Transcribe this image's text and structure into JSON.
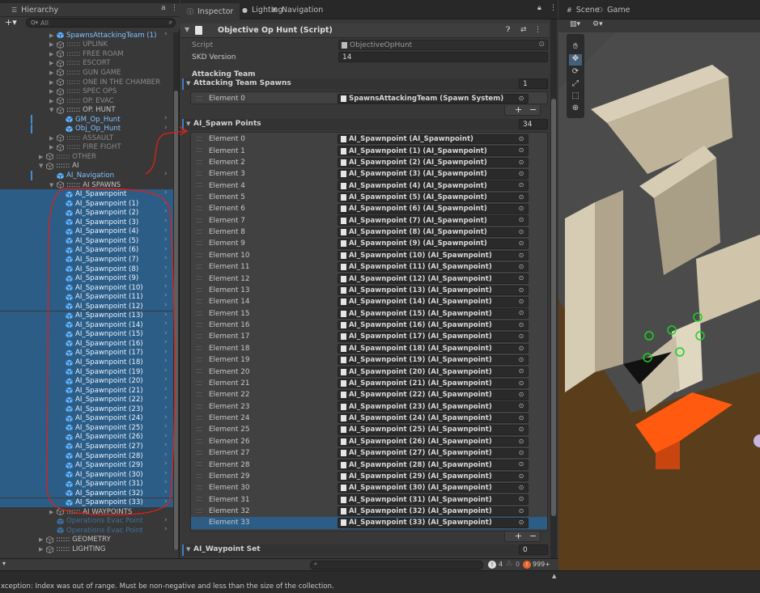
{
  "hierarchy": {
    "tab_label": "Hierarchy",
    "search_placeholder": "All",
    "items": [
      {
        "label": "SpawnsAttackingTeam (1)",
        "kind": "prefab",
        "indent": 1,
        "chev": true,
        "arrow": "▶",
        "blue": true
      },
      {
        "label": ":::::: UPLINK",
        "kind": "group",
        "indent": 1,
        "arrow": "▶",
        "dim": true
      },
      {
        "label": ":::::: FREE ROAM",
        "kind": "group",
        "indent": 1,
        "arrow": "▶",
        "dim": true
      },
      {
        "label": ":::::: ESCORT",
        "kind": "group",
        "indent": 1,
        "arrow": "▶",
        "dim": true
      },
      {
        "label": ":::::: GUN GAME",
        "kind": "group",
        "indent": 1,
        "arrow": "▶",
        "dim": true
      },
      {
        "label": ":::::: ONE IN THE CHAMBER",
        "kind": "group",
        "indent": 1,
        "arrow": "▶",
        "dim": true
      },
      {
        "label": ":::::: SPEC OPS",
        "kind": "group",
        "indent": 1,
        "arrow": "▶",
        "dim": true
      },
      {
        "label": ":::::: OP. EVAC",
        "kind": "group",
        "indent": 1,
        "arrow": "▶",
        "dim": true
      },
      {
        "label": ":::::: OP. HUNT",
        "kind": "group",
        "indent": 1,
        "arrow": "▼"
      },
      {
        "label": "GM_Op_Hunt",
        "kind": "prefab",
        "indent": 2,
        "chev": true,
        "blue": true,
        "mark": true
      },
      {
        "label": "Obj_Op_Hunt",
        "kind": "prefab",
        "indent": 2,
        "chev": true,
        "blue": true,
        "mark": true
      },
      {
        "label": ":::::: ASSAULT",
        "kind": "group",
        "indent": 1,
        "arrow": "▶",
        "dim": true
      },
      {
        "label": ":::::: FIRE FIGHT",
        "kind": "group",
        "indent": 1,
        "arrow": "▶",
        "dim": true
      },
      {
        "label": ":::::: OTHER",
        "kind": "group",
        "indent": 0,
        "arrow": "▶",
        "dim": true
      },
      {
        "label": ":::::: AI",
        "kind": "group",
        "indent": 0,
        "arrow": "▼"
      },
      {
        "label": "AI_Navigation",
        "kind": "prefab",
        "indent": 1,
        "chev": true,
        "blue": true,
        "mark": true
      },
      {
        "label": ":::::: AI SPAWNS",
        "kind": "group",
        "indent": 1,
        "arrow": "▼"
      },
      {
        "label": "AI_Spawnpoint",
        "kind": "prefab",
        "indent": 2,
        "chev": true
      },
      {
        "label": "AI_Spawnpoint (1)",
        "kind": "prefab",
        "indent": 2,
        "chev": true
      },
      {
        "label": "AI_Spawnpoint (2)",
        "kind": "prefab",
        "indent": 2,
        "chev": true
      },
      {
        "label": "AI_Spawnpoint (3)",
        "kind": "prefab",
        "indent": 2,
        "chev": true
      },
      {
        "label": "AI_Spawnpoint (4)",
        "kind": "prefab",
        "indent": 2,
        "chev": true
      },
      {
        "label": "AI_Spawnpoint (5)",
        "kind": "prefab",
        "indent": 2,
        "chev": true
      },
      {
        "label": "AI_Spawnpoint (6)",
        "kind": "prefab",
        "indent": 2,
        "chev": true
      },
      {
        "label": "AI_Spawnpoint (7)",
        "kind": "prefab",
        "indent": 2,
        "chev": true
      },
      {
        "label": "AI_Spawnpoint (8)",
        "kind": "prefab",
        "indent": 2,
        "chev": true
      },
      {
        "label": "AI_Spawnpoint (9)",
        "kind": "prefab",
        "indent": 2,
        "chev": true
      },
      {
        "label": "AI_Spawnpoint (10)",
        "kind": "prefab",
        "indent": 2,
        "chev": true
      },
      {
        "label": "AI_Spawnpoint (11)",
        "kind": "prefab",
        "indent": 2,
        "chev": true
      },
      {
        "label": "AI_Spawnpoint (12)",
        "kind": "prefab",
        "indent": 2,
        "chev": true
      },
      {
        "label": "AI_Spawnpoint (13)",
        "kind": "prefab",
        "indent": 2,
        "chev": true
      },
      {
        "label": "AI_Spawnpoint (14)",
        "kind": "prefab",
        "indent": 2,
        "chev": true
      },
      {
        "label": "AI_Spawnpoint (15)",
        "kind": "prefab",
        "indent": 2,
        "chev": true
      },
      {
        "label": "AI_Spawnpoint (16)",
        "kind": "prefab",
        "indent": 2,
        "chev": true
      },
      {
        "label": "AI_Spawnpoint (17)",
        "kind": "prefab",
        "indent": 2,
        "chev": true
      },
      {
        "label": "AI_Spawnpoint (18)",
        "kind": "prefab",
        "indent": 2,
        "chev": true
      },
      {
        "label": "AI_Spawnpoint (19)",
        "kind": "prefab",
        "indent": 2,
        "chev": true
      },
      {
        "label": "AI_Spawnpoint (20)",
        "kind": "prefab",
        "indent": 2,
        "chev": true
      },
      {
        "label": "AI_Spawnpoint (21)",
        "kind": "prefab",
        "indent": 2,
        "chev": true
      },
      {
        "label": "AI_Spawnpoint (22)",
        "kind": "prefab",
        "indent": 2,
        "chev": true
      },
      {
        "label": "AI_Spawnpoint (23)",
        "kind": "prefab",
        "indent": 2,
        "chev": true
      },
      {
        "label": "AI_Spawnpoint (24)",
        "kind": "prefab",
        "indent": 2,
        "chev": true
      },
      {
        "label": "AI_Spawnpoint (25)",
        "kind": "prefab",
        "indent": 2,
        "chev": true
      },
      {
        "label": "AI_Spawnpoint (26)",
        "kind": "prefab",
        "indent": 2,
        "chev": true
      },
      {
        "label": "AI_Spawnpoint (27)",
        "kind": "prefab",
        "indent": 2,
        "chev": true
      },
      {
        "label": "AI_Spawnpoint (28)",
        "kind": "prefab",
        "indent": 2,
        "chev": true
      },
      {
        "label": "AI_Spawnpoint (29)",
        "kind": "prefab",
        "indent": 2,
        "chev": true
      },
      {
        "label": "AI_Spawnpoint (30)",
        "kind": "prefab",
        "indent": 2,
        "chev": true
      },
      {
        "label": "AI_Spawnpoint (31)",
        "kind": "prefab",
        "indent": 2,
        "chev": true
      },
      {
        "label": "AI_Spawnpoint (32)",
        "kind": "prefab",
        "indent": 2,
        "chev": true
      },
      {
        "label": "AI_Spawnpoint (33)",
        "kind": "prefab",
        "indent": 2,
        "chev": true
      },
      {
        "label": ":::::: AI WAYPOINTS",
        "kind": "group",
        "indent": 1,
        "arrow": "▶"
      },
      {
        "label": "Operations Evac Point",
        "kind": "prefab",
        "indent": 1,
        "chev": true,
        "faded": true
      },
      {
        "label": "Operations Evac Point",
        "kind": "prefab",
        "indent": 1,
        "chev": true,
        "faded": true
      },
      {
        "label": ":::::: GEOMETRY",
        "kind": "group",
        "indent": 0,
        "arrow": "▶"
      },
      {
        "label": ":::::: LIGHTING",
        "kind": "group",
        "indent": 0,
        "arrow": "▶"
      }
    ]
  },
  "inspector": {
    "tabs": [
      {
        "label": "Inspector",
        "icon": "info-icon"
      },
      {
        "label": "Lighting",
        "icon": "bulb-icon"
      },
      {
        "label": "Navigation",
        "icon": "navigation-icon"
      }
    ],
    "component_title": "Objective Op Hunt (Script)",
    "script_label": "Script",
    "script_value": "ObjectiveOpHunt",
    "skd_label": "SKD Version",
    "skd_value": "14",
    "attacking_team_header": "Attacking Team",
    "attacking_spawns_label": "Attacking Team Spawns",
    "attacking_spawns_count": "1",
    "attacking_elements": [
      {
        "label": "Element 0",
        "value": "SpawnsAttackingTeam (Spawn System)"
      }
    ],
    "ai_spawn_label": "AI_Spawn Points",
    "ai_spawn_count": "34",
    "ai_elements": [
      {
        "label": "Element 0",
        "value": "AI_Spawnpoint (AI_Spawnpoint)"
      },
      {
        "label": "Element 1",
        "value": "AI_Spawnpoint (1) (AI_Spawnpoint)"
      },
      {
        "label": "Element 2",
        "value": "AI_Spawnpoint (2) (AI_Spawnpoint)"
      },
      {
        "label": "Element 3",
        "value": "AI_Spawnpoint (3) (AI_Spawnpoint)"
      },
      {
        "label": "Element 4",
        "value": "AI_Spawnpoint (4) (AI_Spawnpoint)"
      },
      {
        "label": "Element 5",
        "value": "AI_Spawnpoint (5) (AI_Spawnpoint)"
      },
      {
        "label": "Element 6",
        "value": "AI_Spawnpoint (6) (AI_Spawnpoint)"
      },
      {
        "label": "Element 7",
        "value": "AI_Spawnpoint (7) (AI_Spawnpoint)"
      },
      {
        "label": "Element 8",
        "value": "AI_Spawnpoint (8) (AI_Spawnpoint)"
      },
      {
        "label": "Element 9",
        "value": "AI_Spawnpoint (9) (AI_Spawnpoint)"
      },
      {
        "label": "Element 10",
        "value": "AI_Spawnpoint (10) (AI_Spawnpoint)"
      },
      {
        "label": "Element 11",
        "value": "AI_Spawnpoint (11) (AI_Spawnpoint)"
      },
      {
        "label": "Element 12",
        "value": "AI_Spawnpoint (12) (AI_Spawnpoint)"
      },
      {
        "label": "Element 13",
        "value": "AI_Spawnpoint (13) (AI_Spawnpoint)"
      },
      {
        "label": "Element 14",
        "value": "AI_Spawnpoint (14) (AI_Spawnpoint)"
      },
      {
        "label": "Element 15",
        "value": "AI_Spawnpoint (15) (AI_Spawnpoint)"
      },
      {
        "label": "Element 16",
        "value": "AI_Spawnpoint (16) (AI_Spawnpoint)"
      },
      {
        "label": "Element 17",
        "value": "AI_Spawnpoint (17) (AI_Spawnpoint)"
      },
      {
        "label": "Element 18",
        "value": "AI_Spawnpoint (18) (AI_Spawnpoint)"
      },
      {
        "label": "Element 19",
        "value": "AI_Spawnpoint (19) (AI_Spawnpoint)"
      },
      {
        "label": "Element 20",
        "value": "AI_Spawnpoint (20) (AI_Spawnpoint)"
      },
      {
        "label": "Element 21",
        "value": "AI_Spawnpoint (21) (AI_Spawnpoint)"
      },
      {
        "label": "Element 22",
        "value": "AI_Spawnpoint (22) (AI_Spawnpoint)"
      },
      {
        "label": "Element 23",
        "value": "AI_Spawnpoint (23) (AI_Spawnpoint)"
      },
      {
        "label": "Element 24",
        "value": "AI_Spawnpoint (24) (AI_Spawnpoint)"
      },
      {
        "label": "Element 25",
        "value": "AI_Spawnpoint (25) (AI_Spawnpoint)"
      },
      {
        "label": "Element 26",
        "value": "AI_Spawnpoint (26) (AI_Spawnpoint)"
      },
      {
        "label": "Element 27",
        "value": "AI_Spawnpoint (27) (AI_Spawnpoint)"
      },
      {
        "label": "Element 28",
        "value": "AI_Spawnpoint (28) (AI_Spawnpoint)"
      },
      {
        "label": "Element 29",
        "value": "AI_Spawnpoint (29) (AI_Spawnpoint)"
      },
      {
        "label": "Element 30",
        "value": "AI_Spawnpoint (30) (AI_Spawnpoint)"
      },
      {
        "label": "Element 31",
        "value": "AI_Spawnpoint (31) (AI_Spawnpoint)"
      },
      {
        "label": "Element 32",
        "value": "AI_Spawnpoint (32) (AI_Spawnpoint)"
      },
      {
        "label": "Element 33",
        "value": "AI_Spawnpoint (33) (AI_Spawnpoint)"
      }
    ],
    "waypoint_label": "AI_Waypoint Set",
    "waypoint_count": "0",
    "add_symbol": "+",
    "remove_symbol": "−"
  },
  "scene": {
    "tabs": [
      {
        "label": "Scene",
        "icon": "scene-grid-icon"
      },
      {
        "label": "Game",
        "icon": "gamepad-icon"
      }
    ]
  },
  "console": {
    "message": "xception: Index was out of range. Must be non-negative and less than the size of the collection.",
    "info_count": "4",
    "warning_count": "0",
    "error_count": "999+"
  },
  "colors": {
    "selection": "#2c5d87",
    "prefab_blue": "#7fc3ff",
    "annotation_red": "#e0201a",
    "scene_floor": "#5a3e1c",
    "orange_block": "#ff5a10"
  }
}
